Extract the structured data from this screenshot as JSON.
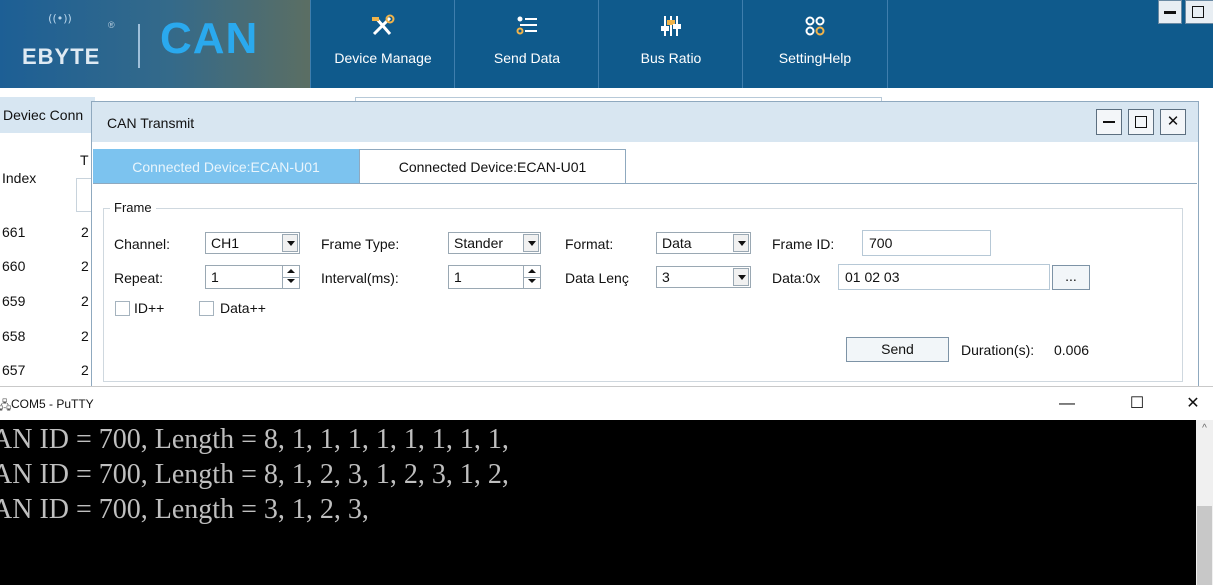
{
  "app": {
    "logo": {
      "brand": "EBYTE",
      "product": "CAN"
    },
    "nav": [
      {
        "label": "Device Manage",
        "icon": "tools-icon"
      },
      {
        "label": "Send Data",
        "icon": "list-icon"
      },
      {
        "label": "Bus Ratio",
        "icon": "sliders-icon"
      },
      {
        "label": "SettingHelp",
        "icon": "grid-icon"
      }
    ],
    "background": {
      "conn_label": "Deviec Conn",
      "index_header": "Index",
      "t_header": "T",
      "rows": [
        {
          "index": "661",
          "col": "2"
        },
        {
          "index": "660",
          "col": "2"
        },
        {
          "index": "659",
          "col": "2"
        },
        {
          "index": "658",
          "col": "2"
        },
        {
          "index": "657",
          "col": "2"
        }
      ]
    }
  },
  "dialog": {
    "title": "CAN Transmit",
    "tabs": [
      {
        "label": "Connected Device:ECAN-U01",
        "active": true
      },
      {
        "label": "Connected Device:ECAN-U01",
        "active": false
      }
    ],
    "frame": {
      "legend": "Frame",
      "channel_label": "Channel:",
      "channel_value": "CH1",
      "frame_type_label": "Frame Type:",
      "frame_type_value": "Stander",
      "format_label": "Format:",
      "format_value": "Data",
      "frame_id_label": "Frame ID:",
      "frame_id_value": "700",
      "repeat_label": "Repeat:",
      "repeat_value": "1",
      "interval_label": "Interval(ms):",
      "interval_value": "1",
      "data_len_label": "Data Lenç",
      "data_len_value": "3",
      "data_label": "Data:0x",
      "data_value": "01 02 03",
      "browse_label": "...",
      "id_inc_label": "ID++",
      "data_inc_label": "Data++",
      "send_label": "Send",
      "duration_label": "Duration(s):",
      "duration_value": "0.006"
    }
  },
  "putty": {
    "title": "COM5 - PuTTY",
    "lines": [
      "AN ID = 700, Length = 8, 1, 1, 1, 1, 1, 1, 1, 1,",
      "AN ID = 700, Length = 8, 1, 2, 3, 1, 2, 3, 1, 2,",
      "AN ID = 700, Length = 3, 1, 2, 3,"
    ]
  }
}
